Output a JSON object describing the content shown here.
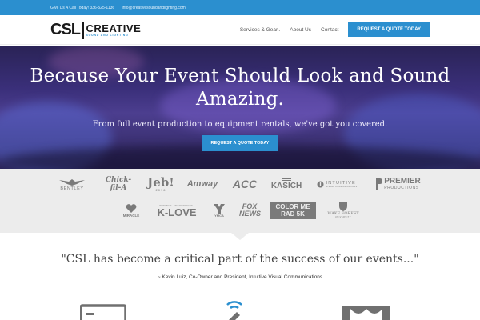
{
  "topbar": {
    "call_text": "Give Us A Call Today! 336-525-1136",
    "separator": "|",
    "email": "info@creativesoundandlighting.com"
  },
  "header": {
    "logo_csl": "CSL",
    "logo_creative": "CREATIVE",
    "logo_sub": "SOUND AND LIGHTING",
    "nav": [
      {
        "label": "Services & Gear"
      },
      {
        "label": "About Us"
      },
      {
        "label": "Contact"
      }
    ],
    "cta_label": "REQUEST A QUOTE TODAY"
  },
  "hero": {
    "title": "Because Your Event Should Look and Sound Amazing.",
    "subtitle": "From full event production to equipment rentals, we've got you covered.",
    "button_label": "REQUEST A QUOTE TODAY"
  },
  "clients": {
    "row1": [
      {
        "name": "BENTLEY"
      },
      {
        "name": "Chick-fil-A"
      },
      {
        "name": "Jeb!",
        "sub": "2016"
      },
      {
        "name": "Amway"
      },
      {
        "name": "ACC"
      },
      {
        "name": "KASICH"
      },
      {
        "name": "INTUITIVE",
        "sub": "VISUAL COMMUNICATIONS"
      },
      {
        "name": "PREMIER",
        "sub": "PRODUCTIONS"
      }
    ],
    "row2": [
      {
        "name": "MIRACLE"
      },
      {
        "name": "K-LOVE",
        "sub": "POSITIVE. ENCOURAGING."
      },
      {
        "name": "YMCA"
      },
      {
        "name": "FOX NEWS"
      },
      {
        "name": "COLOR ME RAD 5K"
      },
      {
        "name": "WAKE FOREST",
        "sub": "UNIVERSITY"
      }
    ]
  },
  "testimonial": {
    "quote": "\"CSL has become a critical part of the success of our events...\"",
    "attribution": "~ Kevin Luiz, Co-Owner and President, Intuitive Visual Communications"
  },
  "colors": {
    "accent": "#2b8fcf",
    "hero_dark": "#2a2356",
    "hero_mid": "#4c3e8f",
    "client_bg": "#ececec",
    "logo_gray": "#7a7a7a"
  },
  "icons": [
    "screen-icon",
    "wifi-tool-icon",
    "stage-curtain-icon",
    "bentley-wings-icon",
    "k-band-icon",
    "intuitive-circle-icon",
    "premier-p-icon",
    "miracle-heart-icon",
    "ymca-y-icon",
    "wake-forest-shield-icon"
  ]
}
